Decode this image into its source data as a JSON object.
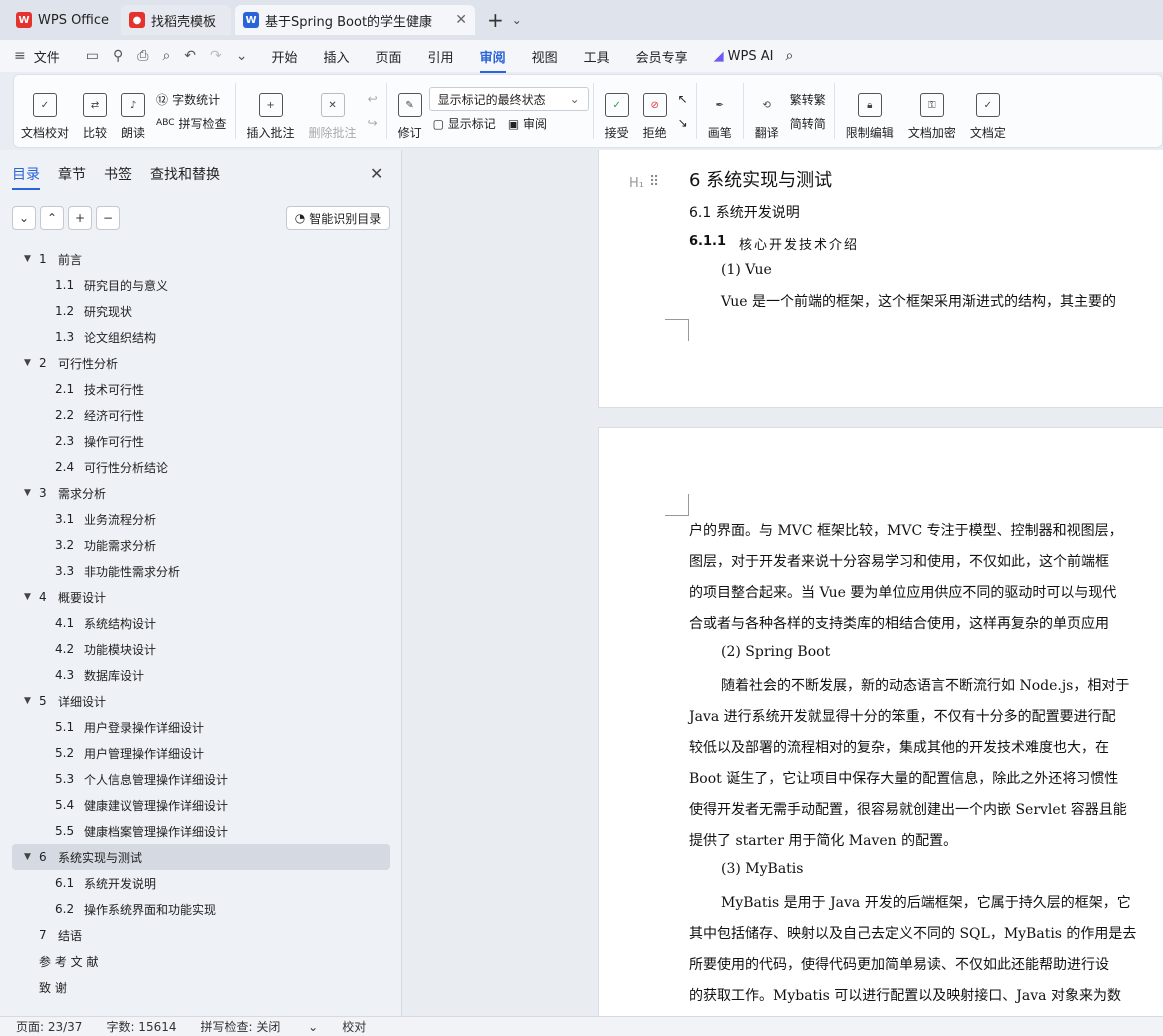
{
  "tabs": [
    {
      "label": "WPS Office"
    },
    {
      "label": "找稻壳模板"
    },
    {
      "label": "基于Spring Boot的学生健康"
    }
  ],
  "menu": {
    "file": "文件",
    "items": [
      "开始",
      "插入",
      "页面",
      "引用",
      "审阅",
      "视图",
      "工具",
      "会员专享"
    ],
    "ai": "WPS AI"
  },
  "ribbon": {
    "doc_check": "文档校对",
    "compare": "比较",
    "read": "朗读",
    "word_count": "字数统计",
    "spell_check": "拼写检查",
    "insert_comment": "插入批注",
    "delete_comment": "删除批注",
    "revise": "修订",
    "display_state": "显示标记的最终状态",
    "show_marks": "显示标记",
    "review": "审阅",
    "accept": "接受",
    "reject": "拒绝",
    "pen": "画笔",
    "translate": "翻译",
    "to_traditional": "转繁",
    "to_simplified": "转简",
    "restrict_edit": "限制编辑",
    "encrypt": "文档加密",
    "doc_more": "文档定"
  },
  "sidebar": {
    "tabs": [
      "目录",
      "章节",
      "书签",
      "查找和替换"
    ],
    "smart_btn": "智能识别目录",
    "toc": [
      {
        "n": "1",
        "t": "前言",
        "lvl": 1,
        "exp": true
      },
      {
        "n": "1.1",
        "t": "研究目的与意义",
        "lvl": 2
      },
      {
        "n": "1.2",
        "t": "研究现状",
        "lvl": 2
      },
      {
        "n": "1.3",
        "t": "论文组织结构",
        "lvl": 2
      },
      {
        "n": "2",
        "t": "可行性分析",
        "lvl": 1,
        "exp": true
      },
      {
        "n": "2.1",
        "t": "技术可行性",
        "lvl": 2
      },
      {
        "n": "2.2",
        "t": "经济可行性",
        "lvl": 2
      },
      {
        "n": "2.3",
        "t": "操作可行性",
        "lvl": 2
      },
      {
        "n": "2.4",
        "t": "可行性分析结论",
        "lvl": 2
      },
      {
        "n": "3",
        "t": "需求分析",
        "lvl": 1,
        "exp": true
      },
      {
        "n": "3.1",
        "t": "业务流程分析",
        "lvl": 2
      },
      {
        "n": "3.2",
        "t": "功能需求分析",
        "lvl": 2
      },
      {
        "n": "3.3",
        "t": "非功能性需求分析",
        "lvl": 2
      },
      {
        "n": "4",
        "t": "概要设计",
        "lvl": 1,
        "exp": true
      },
      {
        "n": "4.1",
        "t": "系统结构设计",
        "lvl": 2
      },
      {
        "n": "4.2",
        "t": "功能模块设计",
        "lvl": 2
      },
      {
        "n": "4.3",
        "t": "数据库设计",
        "lvl": 2
      },
      {
        "n": "5",
        "t": "详细设计",
        "lvl": 1,
        "exp": true
      },
      {
        "n": "5.1",
        "t": "用户登录操作详细设计",
        "lvl": 2
      },
      {
        "n": "5.2",
        "t": "用户管理操作详细设计",
        "lvl": 2
      },
      {
        "n": "5.3",
        "t": "个人信息管理操作详细设计",
        "lvl": 2
      },
      {
        "n": "5.4",
        "t": "健康建议管理操作详细设计",
        "lvl": 2
      },
      {
        "n": "5.5",
        "t": "健康档案管理操作详细设计",
        "lvl": 2
      },
      {
        "n": "6",
        "t": "系统实现与测试",
        "lvl": 1,
        "exp": true,
        "sel": true
      },
      {
        "n": "6.1",
        "t": "系统开发说明",
        "lvl": 2
      },
      {
        "n": "6.2",
        "t": "操作系统界面和功能实现",
        "lvl": 2
      },
      {
        "n": "7",
        "t": "结语",
        "lvl": 1
      },
      {
        "n": "",
        "t": "参 考 文 献",
        "lvl": 1
      },
      {
        "n": "",
        "t": "致        谢",
        "lvl": 1
      }
    ]
  },
  "doc": {
    "h1": "6   系统实现与测试",
    "h2": "6.1   系统开发说明",
    "h3": "6.1.1",
    "h3t": "核心开发技术介绍",
    "vue_h": "(1)  Vue",
    "vue_p": "Vue 是一个前端的框架，这个框架采用渐进式的结构，其主要的",
    "p2": [
      "户的界面。与 MVC 框架比较，MVC 专注于模型、控制器和视图层，",
      "图层，对于开发者来说十分容易学习和使用，不仅如此，这个前端框",
      "的项目整合起来。当 Vue 要为单位应用供应不同的驱动时可以与现代",
      "合或者与各种各样的支持类库的相结合使用，这样再复杂的单页应用"
    ],
    "sb_h": "(2)  Spring Boot",
    "p3": [
      "随着社会的不断发展，新的动态语言不断流行如 Node.js，相对于",
      "Java 进行系统开发就显得十分的笨重，不仅有十分多的配置要进行配",
      "较低以及部署的流程相对的复杂，集成其他的开发技术难度也大，在",
      "Boot 诞生了，它让项目中保存大量的配置信息，除此之外还将习惯性",
      "使得开发者无需手动配置，很容易就创建出一个内嵌 Servlet 容器且能",
      "提供了 starter 用于简化 Maven 的配置。"
    ],
    "mb_h": "(3)  MyBatis",
    "p4": [
      "MyBatis 是用于 Java 开发的后端框架，它属于持久层的框架，它",
      "其中包括储存、映射以及自己去定义不同的 SQL，MyBatis 的作用是去",
      "所要使用的代码，使得代码更加简单易读、不仅如此还能帮助进行设",
      "的获取工作。Mybatis 可以进行配置以及映射接口、Java 对象来为数"
    ]
  },
  "status": {
    "page": "页面: 23/37",
    "words": "字数: 15614",
    "spell": "拼写检查: 关闭",
    "proof": "校对"
  }
}
